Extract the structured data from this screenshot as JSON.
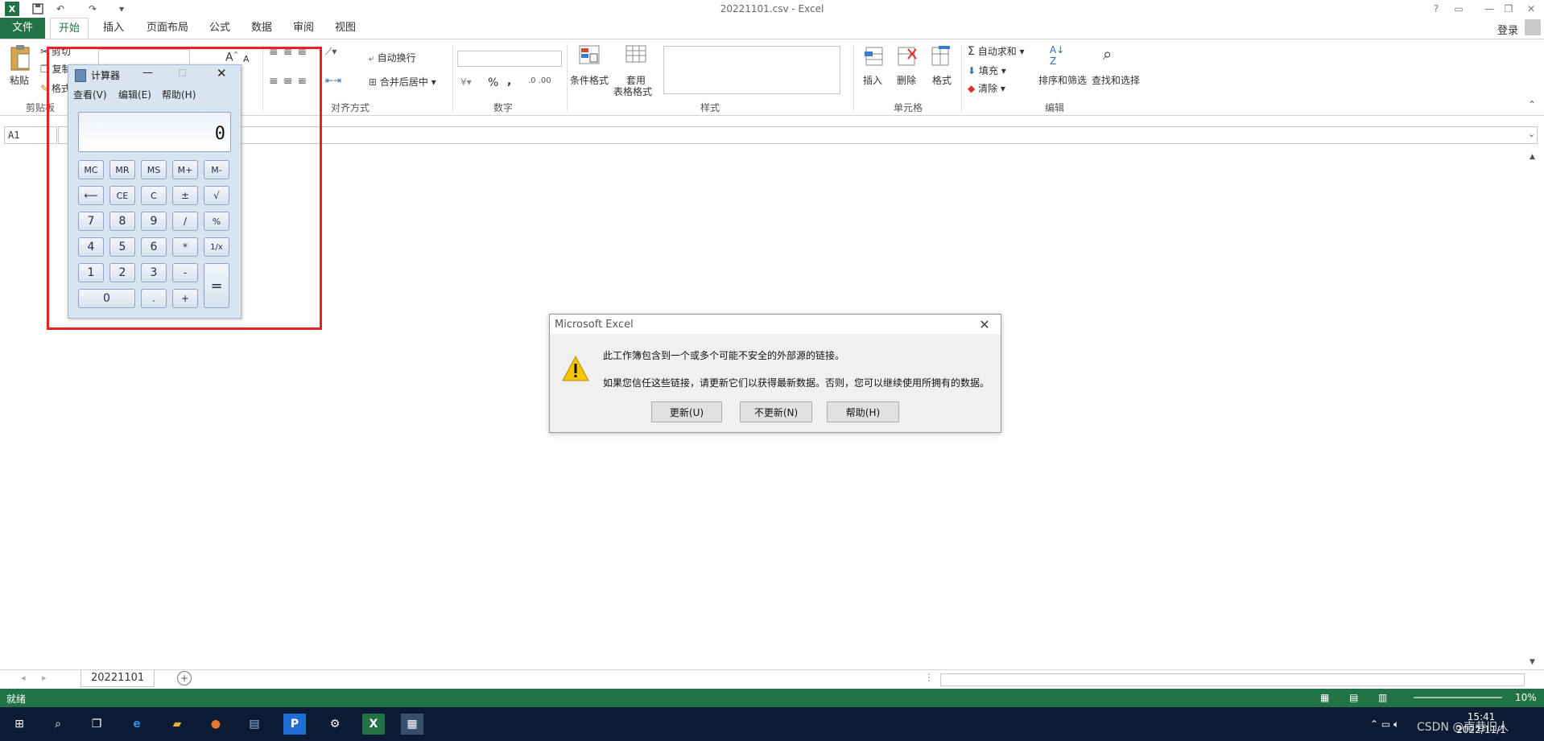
{
  "titlebar": {
    "title": "20221101.csv - Excel",
    "login": "登录",
    "help": "?"
  },
  "tabs": [
    "文件",
    "开始",
    "插入",
    "页面布局",
    "公式",
    "数据",
    "审阅",
    "视图"
  ],
  "ribbon": {
    "clipboard": {
      "paste": "粘贴",
      "cut": "剪切",
      "copy": "复制",
      "format": "格式",
      "label": "剪贴板"
    },
    "alignment": {
      "wrap": "自动换行",
      "merge": "合并后居中",
      "label": "对齐方式"
    },
    "number": {
      "percent": "%",
      "comma": ",",
      "label": "数字"
    },
    "styles": {
      "cond": "条件格式",
      "table1": "套用",
      "table2": "表格格式",
      "label": "样式"
    },
    "cells": {
      "insert": "插入",
      "delete": "删除",
      "format": "格式",
      "label": "单元格"
    },
    "editing": {
      "autosum": "自动求和",
      "fill": "填充",
      "clear": "清除",
      "sort": "排序和筛选",
      "find": "查找和选择",
      "label": "编辑"
    }
  },
  "formula_bar": {
    "namebox": "A1"
  },
  "sheet": {
    "tab": "20221101"
  },
  "status": {
    "ready": "就绪",
    "zoom": "10%"
  },
  "taskbar": {
    "time": "15:41",
    "date": "2022/11/1",
    "watermark": "CSDN @南巷旧人"
  },
  "calculator": {
    "title": "计算器",
    "menu": [
      "查看(V)",
      "编辑(E)",
      "帮助(H)"
    ],
    "display": "0",
    "keys": {
      "row1": [
        "MC",
        "MR",
        "MS",
        "M+",
        "M-"
      ],
      "row2": [
        "⟵",
        "CE",
        "C",
        "±",
        "√"
      ],
      "row3": [
        "7",
        "8",
        "9",
        "/",
        "%"
      ],
      "row4": [
        "4",
        "5",
        "6",
        "*",
        "1/x"
      ],
      "row5": [
        "1",
        "2",
        "3",
        "-"
      ],
      "row6": [
        "0",
        ".",
        "+"
      ],
      "equals": "="
    }
  },
  "dialog": {
    "title": "Microsoft Excel",
    "line1": "此工作簿包含到一个或多个可能不安全的外部源的链接。",
    "line2": "如果您信任这些链接，请更新它们以获得最新数据。否则，您可以继续使用所拥有的数据。",
    "btn_update": "更新(U)",
    "btn_noupdate": "不更新(N)",
    "btn_help": "帮助(H)"
  }
}
